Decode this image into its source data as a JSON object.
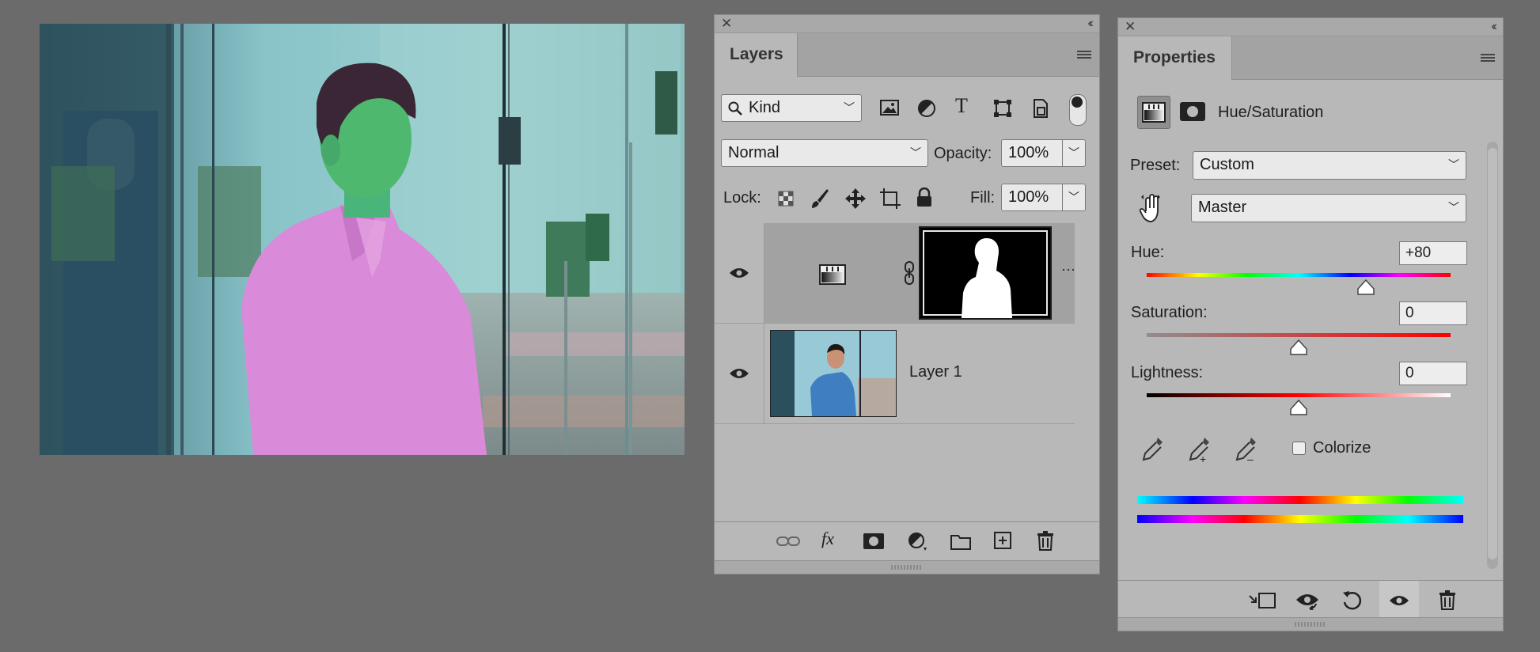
{
  "layers_panel": {
    "tab": "Layers",
    "filter": {
      "kind_label": "Kind"
    },
    "blend_mode": "Normal",
    "opacity": {
      "label": "Opacity:",
      "value": "100%"
    },
    "lock_label": "Lock:",
    "fill": {
      "label": "Fill:",
      "value": "100%"
    },
    "layers": [
      {
        "name": "",
        "type": "hue-saturation-adjustment",
        "visible": true,
        "selected": true
      },
      {
        "name": "Layer 1",
        "type": "pixel",
        "visible": true,
        "selected": false
      }
    ],
    "more_glyph": "···"
  },
  "properties_panel": {
    "tab": "Properties",
    "title": "Hue/Saturation",
    "preset": {
      "label": "Preset:",
      "value": "Custom"
    },
    "channel": {
      "value": "Master"
    },
    "hue": {
      "label": "Hue:",
      "value": "+80",
      "min": -180,
      "max": 180,
      "current": 80
    },
    "saturation": {
      "label": "Saturation:",
      "value": "0",
      "min": -100,
      "max": 100,
      "current": 0
    },
    "lightness": {
      "label": "Lightness:",
      "value": "0",
      "min": -100,
      "max": 100,
      "current": 0
    },
    "colorize": {
      "label": "Colorize",
      "checked": false
    }
  },
  "colors": {
    "app_bg": "#6b6b6b",
    "panel_bg": "#b8b8b8",
    "selected_layer": "#a2a2a2"
  }
}
